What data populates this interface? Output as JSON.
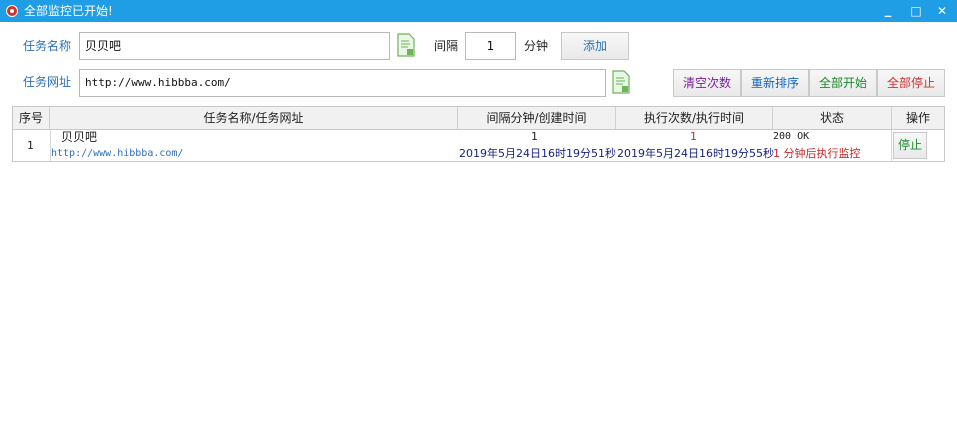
{
  "window": {
    "title": "全部监控已开始!",
    "minimize": "_",
    "maximize": "□",
    "close": "✕"
  },
  "form": {
    "task_name_label": "任务名称",
    "task_name_value": "贝贝吧",
    "interval_label": "间隔",
    "interval_value": "1",
    "minutes_label": "分钟",
    "add_button": "添加",
    "task_url_label": "任务网址",
    "task_url_value": "http://www.hibbba.com/"
  },
  "actions": {
    "clear_count": "清空次数",
    "resort": "重新排序",
    "start_all": "全部开始",
    "stop_all": "全部停止"
  },
  "table": {
    "columns": [
      "序号",
      "任务名称/任务网址",
      "间隔分钟/创建时间",
      "执行次数/执行时间",
      "状态",
      "操作"
    ],
    "rows": [
      {
        "index": "1",
        "name": "贝贝吧",
        "url": "http://www.hibbba.com/",
        "interval": "1",
        "created": "2019年5月24日16时19分51秒",
        "count": "1",
        "executed": "2019年5月24日16时19分55秒",
        "status_code": "200 OK",
        "status_msg": "1 分钟后执行监控",
        "action": "停止"
      }
    ]
  },
  "colors": {
    "titlebar": "#1f9ee6",
    "label_blue": "#2a6fb8",
    "date_navy": "#1a237e",
    "count_red": "#c62828",
    "clear_purple": "#7b1fa2",
    "resort_blue": "#1565c0",
    "start_green": "#1a8a2a",
    "stop_red": "#d32f2f"
  }
}
